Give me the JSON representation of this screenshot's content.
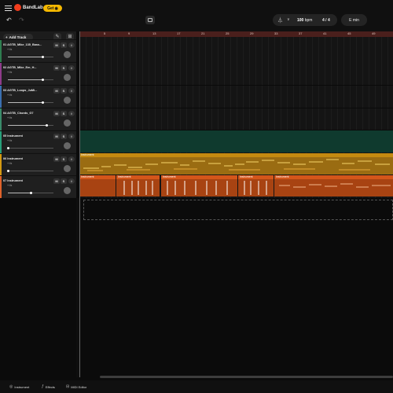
{
  "header": {
    "brand": "BandLab",
    "get_label": "Get",
    "tempo_value": "100",
    "tempo_unit": "bpm",
    "time_signature": "4 / 4",
    "key": "E min"
  },
  "track_panel": {
    "add_track_label": "Add Track",
    "tracks": [
      {
        "name": "01  AGTB_Mike_135_Bass...",
        "fx": "+ fx",
        "mute": "M",
        "solo": "S",
        "volume": 0.76,
        "color": "#2e7d4f"
      },
      {
        "name": "02  AGTB_Mike_Em_H...",
        "fx": "+ fx",
        "mute": "M",
        "solo": "S",
        "volume": 0.76,
        "color": "#8e3b8a"
      },
      {
        "name": "03  AGTB_Loops_JuMi...",
        "fx": "+ fx",
        "mute": "M",
        "solo": "S",
        "volume": 0.76,
        "color": "#3a6fb0"
      },
      {
        "name": "04  AGTB_Chords_G7",
        "fx": "+ fx",
        "mute": "M",
        "solo": "S",
        "volume": 0.86,
        "color": "#3a8b6a"
      },
      {
        "name": "05  Instrument",
        "fx": "+ fx",
        "mute": "M",
        "solo": "S",
        "volume": 0.0,
        "color": "#27a07a"
      },
      {
        "name": "06  Instrument",
        "fx": "+ fx",
        "mute": "M",
        "solo": "S",
        "volume": 0.0,
        "color": "#d69a12"
      },
      {
        "name": "07  Instrument",
        "fx": "+ fx",
        "mute": "M",
        "solo": "S",
        "volume": 0.5,
        "color": "#e0622a"
      }
    ]
  },
  "timeline": {
    "ruler_marks": [
      "5",
      "9",
      "13",
      "17",
      "21",
      "25",
      "29",
      "33",
      "37",
      "41",
      "45",
      "49"
    ],
    "clips": {
      "yellow_label": "Instrument",
      "orange_labels": [
        "Instrument",
        "Instrument",
        "Instrument",
        "Instrument",
        "Instrument"
      ]
    }
  },
  "footer": {
    "instrument_label": "Instrument",
    "effects_label": "Effects",
    "midi_label": "MIDI Editor"
  },
  "colors": {
    "accent": "#f5b800",
    "ruler": "#4a1f1c",
    "yellow_clip": "#9a6c12",
    "orange_clip": "#a84312",
    "teal_lane": "#0f3a2e"
  }
}
